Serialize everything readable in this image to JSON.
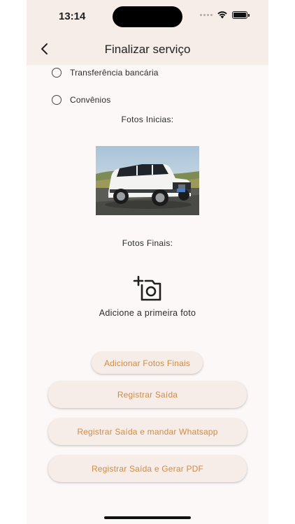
{
  "status": {
    "time": "13:14"
  },
  "header": {
    "title": "Finalizar serviço",
    "back_icon": "chevron-left-icon"
  },
  "payment_options": [
    {
      "label": "Transferência bancária"
    },
    {
      "label": "Convênios"
    }
  ],
  "photos": {
    "initial_label": "Fotos Inicias:",
    "final_label": "Fotos Finais:",
    "empty_text": "Adicione a primeira foto"
  },
  "actions": {
    "add_photos": "Adicionar Fotos Finais",
    "register_exit": "Registrar Saída",
    "register_whatsapp": "Registrar Saída e mandar Whatsapp",
    "register_pdf": "Registrar Saída e Gerar PDF"
  },
  "colors": {
    "accent": "#d28a44",
    "surface": "#f6ede8",
    "background": "#fdf8f8"
  }
}
